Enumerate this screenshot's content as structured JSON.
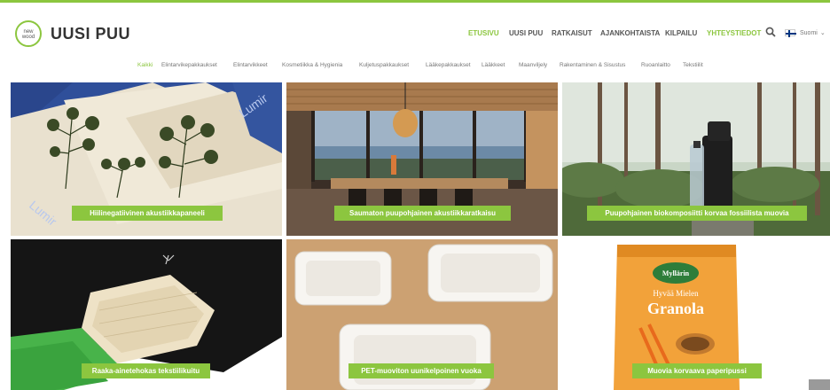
{
  "brand": {
    "logo_line1": "new",
    "logo_line2": "wood",
    "name": "UUSI PUU"
  },
  "colors": {
    "accent": "#8cc63f",
    "nav_text": "#555555"
  },
  "main_nav": [
    {
      "label": "ETUSIVU",
      "active": true
    },
    {
      "label": "UUSI PUU"
    },
    {
      "label": "RATKAISUT"
    },
    {
      "label": "AJANKOHTAISTA"
    },
    {
      "label": "KILPAILU"
    },
    {
      "label": "YHTEYSTIEDOT",
      "highlight": true
    }
  ],
  "search": {
    "icon": "search-icon"
  },
  "language": {
    "label": "Suomi",
    "icon": "finland-flag-icon"
  },
  "filters": [
    "Kaikki",
    "Elintarvikepakkaukset",
    "Elintarvikkeet",
    "Kosmetiikka & Hygienia",
    "Kuljetuspakkaukset",
    "Lääkepakkaukset",
    "Lääkkeet",
    "Maanviljely",
    "Rakentaminen & Sisustus",
    "Ruoanlaitto",
    "Tekstiilit"
  ],
  "tiles": [
    {
      "label": "Hiilinegatiivinen akustiikkapaneeli"
    },
    {
      "label": "Saumaton puupohjainen akustiikkaratkaisu"
    },
    {
      "label": "Puupohjainen biokomposiitti korvaa fossiilista muovia"
    },
    {
      "label": "Raaka-ainetehokas tekstiilikuitu"
    },
    {
      "label": "PET-muoviton uunikelpoinen vuoka"
    },
    {
      "label": "Muovia korvaava paperipussi"
    }
  ],
  "tile_images": {
    "panel_text": "Lumir",
    "granola_brand": "Myllärin",
    "granola_line1": "Hyvää Mielen",
    "granola_line2": "Granola"
  }
}
